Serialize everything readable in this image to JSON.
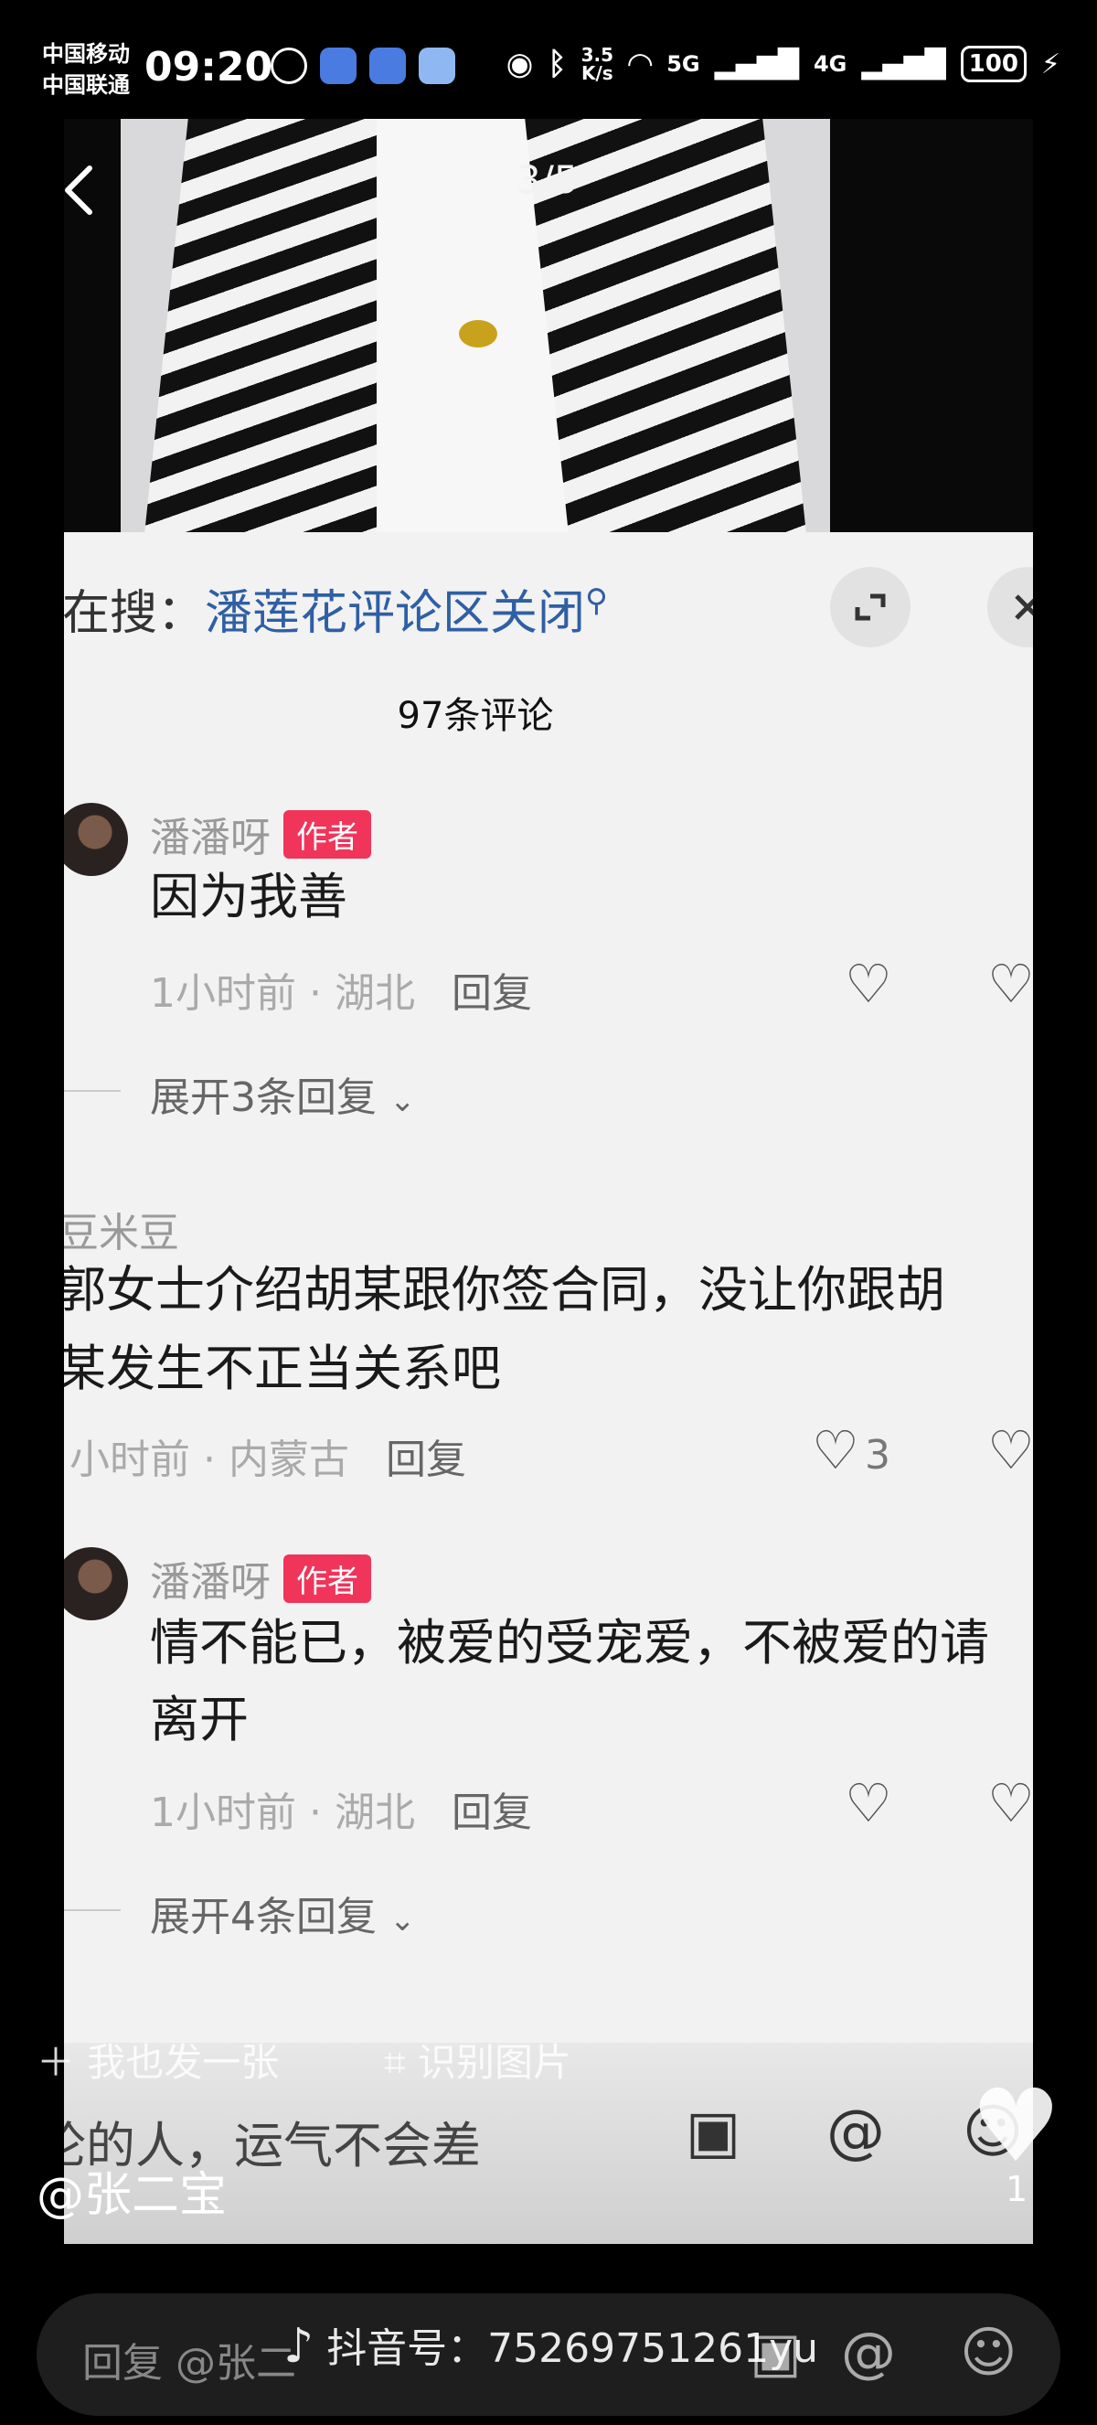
{
  "status_bar": {
    "carrier1": "中国移动",
    "carrier2": "中国联通",
    "time": "09:20",
    "speed_value": "3.5",
    "speed_unit": "K/s",
    "net1": "5G",
    "net2": "4G",
    "battery": "100"
  },
  "image_viewer": {
    "counter": "3/5"
  },
  "panel": {
    "search_prefix": "在搜：",
    "search_keyword": "潘莲花评论区关闭",
    "comment_count": "97条评论"
  },
  "comments": [
    {
      "user": "潘潘呀",
      "badge": "作者",
      "lines": [
        "因为我善"
      ],
      "time_loc": "1小时前 · 湖北",
      "reply": "回复",
      "expand": "展开3条回复"
    },
    {
      "user": "豆米豆",
      "lines": [
        "郭女士介绍胡某跟你签合同，没让你跟胡",
        "某发生不正当关系吧"
      ],
      "time_loc": "小时前 · 内蒙古",
      "reply": "回复",
      "likes": "3"
    },
    {
      "user": "潘潘呀",
      "badge": "作者",
      "lines": [
        "情不能已，被爱的受宠爱，不被爱的请",
        "离开"
      ],
      "time_loc": "1小时前 · 湖北",
      "reply": "回复",
      "expand": "展开4条回复"
    }
  ],
  "input_area": {
    "partial_text": "论的人，运气不会差"
  },
  "overlays": {
    "post_label": "我也发一张",
    "ocr_label": "识别图片",
    "author": "@张二宝",
    "like_count": "1"
  },
  "reply_bar": {
    "placeholder": "回复 @张二"
  },
  "watermark": "抖音号：75269751261yu"
}
